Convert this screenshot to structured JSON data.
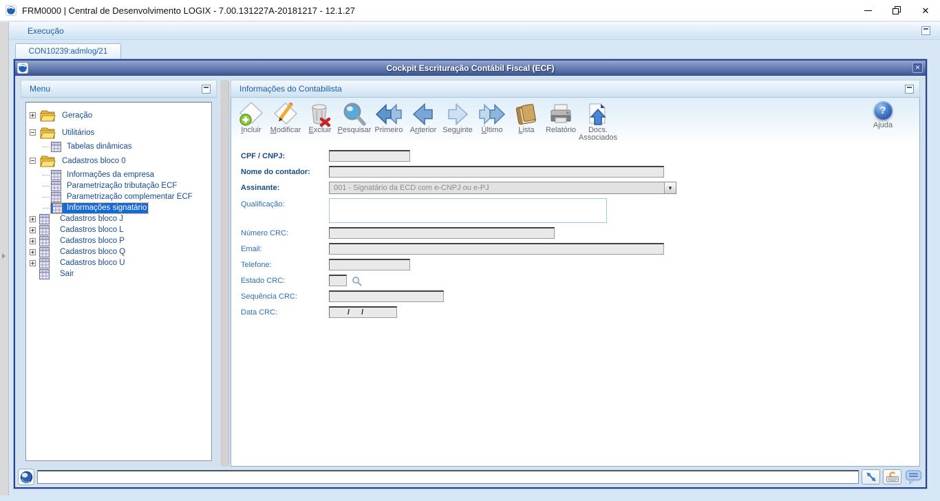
{
  "os": {
    "title": "FRM0000 | Central de Desenvolvimento LOGIX  -  7.00.131227A-20181217  -  12.1.27"
  },
  "menubar": {
    "label": "Execução"
  },
  "tabs": {
    "active": "CON10239:admlog/21"
  },
  "window": {
    "title": "Cockpit Escrituração Contábil Fiscal (ECF)"
  },
  "menu_panel": {
    "title": "Menu",
    "tree": [
      {
        "label": "Geração"
      },
      {
        "label": "Utilitários"
      },
      {
        "label": "Tabelas dinâmicas"
      },
      {
        "label": "Cadastros bloco 0"
      },
      {
        "label": "Informações da empresa"
      },
      {
        "label": "Parametrização tributação ECF"
      },
      {
        "label": "Parametrização complementar ECF"
      },
      {
        "label": "Informações signatário"
      },
      {
        "label": "Cadastros bloco J"
      },
      {
        "label": "Cadastros bloco L"
      },
      {
        "label": "Cadastros bloco P"
      },
      {
        "label": "Cadastros bloco Q"
      },
      {
        "label": "Cadastros bloco U"
      },
      {
        "label": "Sair"
      }
    ]
  },
  "content_panel": {
    "title": "Informações do Contabilista",
    "toolbar": {
      "buttons": [
        {
          "label": "Incluir",
          "underline": 0
        },
        {
          "label": "Modificar",
          "underline": 0
        },
        {
          "label": "Excluir",
          "underline": 0
        },
        {
          "label": "Pesquisar",
          "underline": 0
        },
        {
          "label": "Primeiro",
          "underline": -1
        },
        {
          "label": "Anterior",
          "underline": 1
        },
        {
          "label": "Seguinte",
          "underline": 3
        },
        {
          "label": "Último",
          "underline": 0
        },
        {
          "label": "Lista",
          "underline": 0
        },
        {
          "label": "Relatório",
          "underline": -1
        },
        {
          "label": "Docs. Associados",
          "underline": -1
        }
      ],
      "help_label": "Ajuda"
    },
    "form": {
      "cpf_label": "CPF / CNPJ:",
      "cpf_value": "",
      "nome_label": "Nome do contador:",
      "nome_value": "",
      "assinante_label": "Assinante:",
      "assinante_value": "001 - Signatário da ECD com e-CNPJ ou e-PJ",
      "qualificacao_label": "Qualificação:",
      "qualificacao_value": "",
      "numero_crc_label": "Número CRC:",
      "numero_crc_value": "",
      "email_label": "Email:",
      "email_value": "",
      "telefone_label": "Telefone:",
      "telefone_value": "",
      "estado_crc_label": "Estado CRC:",
      "estado_crc_value": "",
      "sequencia_crc_label": "Sequência CRC:",
      "sequencia_crc_value": "",
      "data_crc_label": "Data CRC:",
      "data_crc_value": "/ /"
    }
  },
  "statusbar": {
    "message": ""
  },
  "colors": {
    "selection_blue": "#1569d8",
    "window_border": "#26418f",
    "accent_blue": "#1f63a8",
    "titlebar_blue": "#5872aa"
  }
}
